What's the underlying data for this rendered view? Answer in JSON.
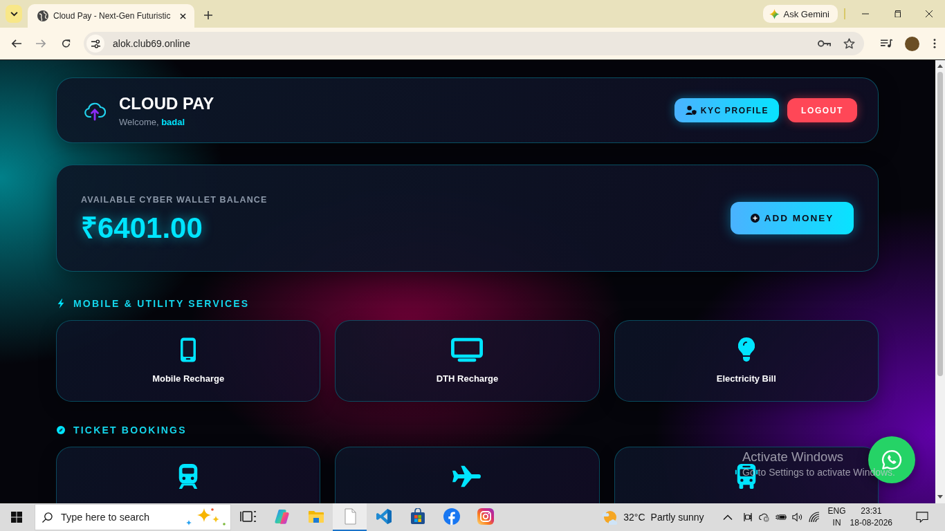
{
  "browser": {
    "tabs": [
      {
        "title": "Cloud Pay - Next-Gen Futuristic",
        "selected": true
      }
    ],
    "ask_gemini": "Ask Gemini",
    "nav": [
      {
        "kind": "back",
        "disabled": false
      },
      {
        "kind": "forward",
        "disabled": true
      },
      {
        "kind": "reload",
        "disabled": false
      }
    ],
    "address": "alok.club69.online"
  },
  "header": {
    "brand": "CLOUD PAY",
    "welcome": "Welcome, **badal**",
    "buttons": [
      {
        "kind": "kyc",
        "label": "KYC PROFILE"
      },
      {
        "kind": "logout",
        "label": "LOGOUT"
      }
    ]
  },
  "wallet": {
    "label": "AVAILABLE CYBER WALLET BALANCE",
    "balance": "₹6401.00",
    "button": "ADD MONEY"
  },
  "sections": [
    {
      "kind": "utility",
      "title": "MOBILE & UTILITY SERVICES",
      "items": [
        {
          "kind": "mobile",
          "label": "Mobile Recharge"
        },
        {
          "kind": "dth",
          "label": "DTH Recharge"
        },
        {
          "kind": "electricity",
          "label": "Electricity Bill"
        }
      ]
    },
    {
      "kind": "tickets",
      "title": "TICKET BOOKINGS",
      "items": [
        {
          "kind": "train"
        },
        {
          "kind": "flight"
        },
        {
          "kind": "bus"
        }
      ]
    }
  ],
  "activation_notice": {
    "title": "Activate Windows",
    "text": "Go to Settings to activate Windows."
  },
  "taskbar": {
    "search_placeholder": "Type here to search",
    "apps": [
      {
        "kind": "task-view",
        "selected": false
      },
      {
        "kind": "copilot",
        "selected": false
      },
      {
        "kind": "explorer",
        "selected": false
      },
      {
        "kind": "document",
        "selected": true
      },
      {
        "kind": "code-editor",
        "selected": false
      },
      {
        "kind": "store",
        "selected": false
      },
      {
        "kind": "facebook",
        "selected": false
      },
      {
        "kind": "instagram",
        "selected": false
      }
    ],
    "weather": {
      "temperature": "32°C",
      "condition": "Partly sunny"
    },
    "language": {
      "code": "ENG",
      "region": "IN"
    },
    "clock": {
      "time": "23:31",
      "date": "18-08-2026"
    }
  }
}
